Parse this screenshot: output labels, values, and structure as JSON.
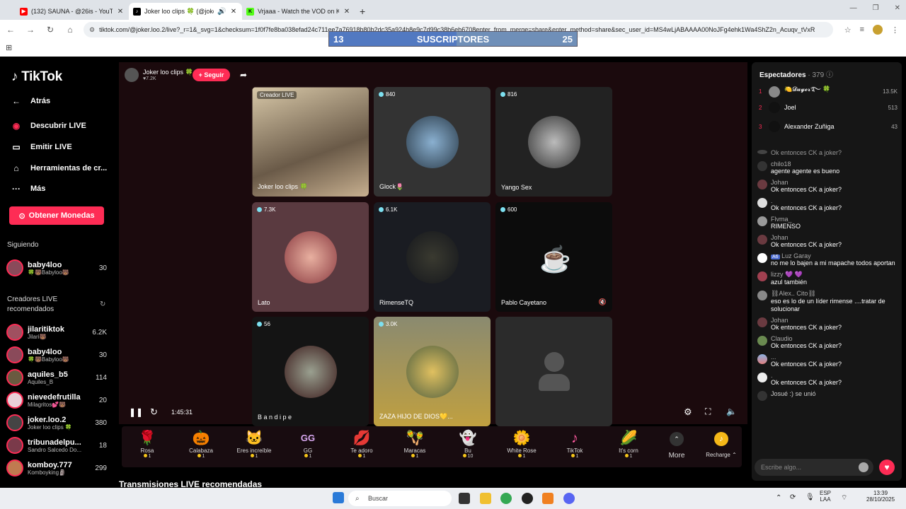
{
  "browser": {
    "tabs": [
      {
        "title": "(132) SAUNA - @26is - YouTube",
        "color": "#ff0000"
      },
      {
        "title": "Joker loo clips 🍀 (@joker.l",
        "color": "#000000"
      },
      {
        "title": "Vrjaaa - Watch the VOD on Kic",
        "color": "#53fc18"
      }
    ],
    "url": "tiktok.com/@joker.loo.2/live?_r=1&_svg=1&checksum=1f0f7fe8ba038efad24c711ee7a76918b80b2dc35a924b8e9c7d99c38b6eb6708enter_from_merge=share&enter_method=share&sec_user_id=MS4wLjABAAAA00NoJFg4ehk1Wa4ShZ2n_Acuqv_tVxR"
  },
  "overlay": {
    "left": "13",
    "title": "SUSCRIPTORES",
    "right": "25"
  },
  "sidebar": {
    "logo": "TikTok",
    "nav": [
      {
        "icon": "←",
        "label": "Atrás"
      },
      {
        "icon": "◉",
        "label": "Descubrir LIVE"
      },
      {
        "icon": "▭",
        "label": "Emitir LIVE"
      },
      {
        "icon": "⌂",
        "label": "Herramientas de cr..."
      },
      {
        "icon": "···",
        "label": "Más"
      }
    ],
    "coins_button": "Obtener Monedas",
    "following_title": "Siguiendo",
    "following": [
      {
        "name": "baby4loo",
        "sub": "🍀🐻Babyloo🐻",
        "count": "30"
      }
    ],
    "recommended_title": "Creadores LIVE recomendados",
    "recommended": [
      {
        "name": "jilaritiktok",
        "sub": "Jilari🐻",
        "count": "6.2K"
      },
      {
        "name": "baby4loo",
        "sub": "🍀🐻Babyloo🐻",
        "count": "30"
      },
      {
        "name": "aquiles_b5",
        "sub": "Aquiles_B",
        "count": "114"
      },
      {
        "name": "nievedefrutilla",
        "sub": "Milagritos💕🐻",
        "count": "20"
      },
      {
        "name": "joker.loo.2",
        "sub": "Joker loo clips 🍀",
        "count": "380"
      },
      {
        "name": "tribunadelpu...",
        "sub": "Sandro Salcedo Do...",
        "count": "18"
      },
      {
        "name": "komboy.777",
        "sub": "Komboyking🗿",
        "count": "299"
      }
    ]
  },
  "host": {
    "name": "Joker loo clips 🍀",
    "likes": "♥7.2K",
    "follow": "+ Seguir"
  },
  "grid": [
    {
      "badge": "Creador LIVE",
      "name": "Joker loo clips 🍀",
      "bg": "#b9a98a"
    },
    {
      "badge": "840",
      "name": "Glock🌷",
      "bg": "#3a3a3a"
    },
    {
      "badge": "816",
      "name": "Yango Sex",
      "bg": "#2a2a2a"
    },
    {
      "badge": "7.3K",
      "name": "Lato",
      "bg": "#5a3a40"
    },
    {
      "badge": "6.1K",
      "name": "RimenseTQ",
      "bg": "#1a1c22"
    },
    {
      "badge": "600",
      "name": "Pablo Cayetano",
      "bg": "#0c0c0c"
    },
    {
      "badge": "56",
      "name": "B a n d i p e",
      "bg": "#141414"
    },
    {
      "badge": "3.0K",
      "name": "ZAZA HIJO DE DIOS💛...",
      "bg": "#8a7a40"
    },
    {
      "badge": "",
      "name": "",
      "bg": "#2b2b2b"
    }
  ],
  "player": {
    "time": "1:45:31"
  },
  "gifts": [
    {
      "icon": "🌹",
      "name": "Rosa",
      "price": "1"
    },
    {
      "icon": "🎃",
      "name": "Calabaza",
      "price": "1"
    },
    {
      "icon": "🐱",
      "name": "Eres increíble",
      "price": "1"
    },
    {
      "icon": "GG",
      "name": "GG",
      "price": "1"
    },
    {
      "icon": "💋",
      "name": "Te adoro",
      "price": "1"
    },
    {
      "icon": "🪇",
      "name": "Maracas",
      "price": "1"
    },
    {
      "icon": "👻",
      "name": "Bu",
      "price": "10"
    },
    {
      "icon": "🌼",
      "name": "White Rose",
      "price": "1"
    },
    {
      "icon": "♪",
      "name": "TikTok",
      "price": "1"
    },
    {
      "icon": "🌽",
      "name": "It's corn",
      "price": "1"
    }
  ],
  "gift_more": "More",
  "recharge": "Recharge ⌃",
  "recommended_live": "Transmisiones LIVE recomendadas",
  "viewers": {
    "title": "Espectadores",
    "count": "· 379",
    "top": [
      {
        "rank": "1",
        "name": "🍋𝓓𝓪𝔂𝓮𝓻࿐ 🍀",
        "count": "13.5K"
      },
      {
        "rank": "2",
        "name": "Joel",
        "count": "513"
      },
      {
        "rank": "3",
        "name": "Alexander Zuñiga",
        "count": "43"
      }
    ]
  },
  "chat": [
    {
      "user": "",
      "text": "Ok entonces CK a joker?"
    },
    {
      "user": "chilo18",
      "text": "agente agente es bueno"
    },
    {
      "user": "Johan",
      "text": "Ok entonces CK a joker?"
    },
    {
      "user": ".",
      "text": "Ok entonces CK a joker?"
    },
    {
      "user": "Flvma_",
      "text": "RIMENSO"
    },
    {
      "user": "Johan",
      "text": "Ok entonces CK a joker?"
    },
    {
      "user": "Luz Garay",
      "text": "no me lo bajen a mi mapache todos aportan"
    },
    {
      "user": "lizzy 💜 💜",
      "text": "azul también"
    },
    {
      "user": "⛓Alex.. Cito⛓",
      "text": "eso es lo de un líder rimense ....tratar de solucionar"
    },
    {
      "user": "Johan",
      "text": "Ok entonces CK a joker?"
    },
    {
      "user": "Claudio",
      "text": "Ok entonces CK a joker?"
    },
    {
      "user": "...",
      "text": "Ok entonces CK a joker?"
    },
    {
      "user": ".",
      "text": "Ok entonces CK a joker?"
    }
  ],
  "joined": "Josué :)  se unió",
  "chat_placeholder": "Escribe algo...",
  "taskbar": {
    "search": "Buscar",
    "lang": "ESP",
    "lang2": "LAA",
    "time": "13:39",
    "date": "28/10/2025"
  }
}
